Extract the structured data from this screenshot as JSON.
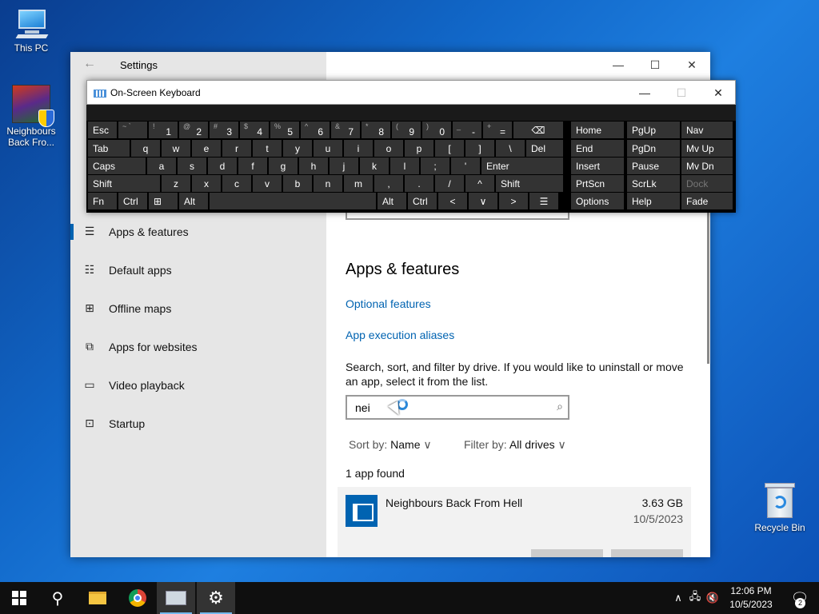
{
  "desktop": {
    "icons": [
      {
        "label": "This PC"
      },
      {
        "label": "Neighbours Back Fro..."
      },
      {
        "label": "Recycle Bin"
      }
    ]
  },
  "settings": {
    "title": "Settings",
    "nav": [
      {
        "label": "Apps & features",
        "icon": "apps-features-icon"
      },
      {
        "label": "Default apps",
        "icon": "default-apps-icon"
      },
      {
        "label": "Offline maps",
        "icon": "offline-maps-icon"
      },
      {
        "label": "Apps for websites",
        "icon": "apps-websites-icon"
      },
      {
        "label": "Video playback",
        "icon": "video-playback-icon"
      },
      {
        "label": "Startup",
        "icon": "startup-icon"
      }
    ],
    "heading": "Apps & features",
    "links": [
      "Optional features",
      "App execution aliases"
    ],
    "description": "Search, sort, and filter by drive. If you would like to uninstall or move an app, select it from the list.",
    "search_value": "nei",
    "sort_label": "Sort by:",
    "sort_value": "Name",
    "filter_label": "Filter by:",
    "filter_value": "All drives",
    "found_text": "1 app found",
    "app": {
      "name": "Neighbours Back From Hell",
      "size": "3.63 GB",
      "date": "10/5/2023"
    }
  },
  "osk": {
    "title": "On-Screen Keyboard",
    "row1": [
      {
        "label": "Esc"
      },
      {
        "sub": "~ `",
        "main": ""
      },
      {
        "sub": "!",
        "main": "1"
      },
      {
        "sub": "@",
        "main": "2"
      },
      {
        "sub": "#",
        "main": "3"
      },
      {
        "sub": "$",
        "main": "4"
      },
      {
        "sub": "%",
        "main": "5"
      },
      {
        "sub": "^",
        "main": "6"
      },
      {
        "sub": "&",
        "main": "7"
      },
      {
        "sub": "*",
        "main": "8"
      },
      {
        "sub": "(",
        "main": "9"
      },
      {
        "sub": ")",
        "main": "0"
      },
      {
        "sub": "_",
        "main": "-"
      },
      {
        "sub": "+",
        "main": "="
      },
      {
        "label": "⌫"
      }
    ],
    "row2": [
      "Tab",
      "q",
      "w",
      "e",
      "r",
      "t",
      "y",
      "u",
      "i",
      "o",
      "p",
      "[",
      "]",
      "\\",
      "Del"
    ],
    "row3": [
      "Caps",
      "a",
      "s",
      "d",
      "f",
      "g",
      "h",
      "j",
      "k",
      "l",
      ";",
      "'",
      "Enter"
    ],
    "row4": [
      "Shift",
      "z",
      "x",
      "c",
      "v",
      "b",
      "n",
      "m",
      ",",
      ".",
      "/",
      "^",
      "Shift"
    ],
    "row5": [
      "Fn",
      "Ctrl",
      "⊞",
      "Alt",
      "",
      "Alt",
      "Ctrl",
      "<",
      "∨",
      ">",
      "☰"
    ],
    "nav_col1": [
      "Home",
      "End",
      "Insert",
      "PrtScn",
      "Options"
    ],
    "nav_col2": [
      "PgUp",
      "PgDn",
      "Pause",
      "ScrLk",
      "Help"
    ],
    "nav_col3": [
      "Nav",
      "Mv Up",
      "Mv Dn",
      "Dock",
      "Fade"
    ]
  },
  "taskbar": {
    "time": "12:06 PM",
    "date": "10/5/2023",
    "notification_count": "2"
  }
}
